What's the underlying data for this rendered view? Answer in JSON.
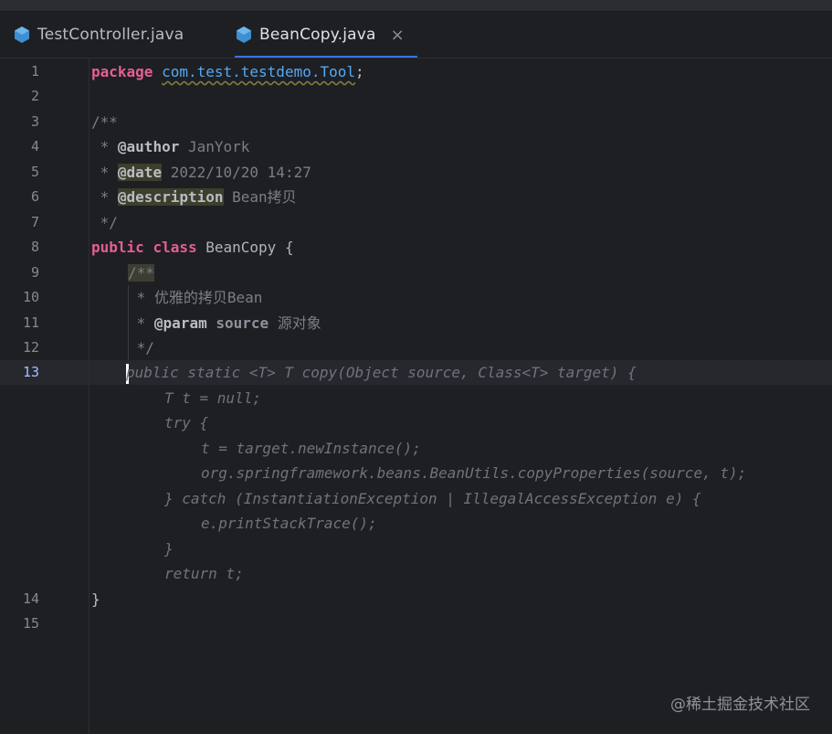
{
  "tabs": [
    {
      "label": "TestController.java",
      "icon": "java-class-icon",
      "active": false
    },
    {
      "label": "BeanCopy.java",
      "icon": "java-class-icon",
      "active": true,
      "close": "×"
    }
  ],
  "lines": {
    "n1": "1",
    "n2": "2",
    "n3": "3",
    "n4": "4",
    "n5": "5",
    "n6": "6",
    "n7": "7",
    "n8": "8",
    "n9": "9",
    "n10": "10",
    "n11": "11",
    "n12": "12",
    "n13": "13",
    "n14": "14",
    "n15": "15"
  },
  "code": {
    "l1_kw": "package",
    "l1_pkg": "com.test.testdemo.Tool",
    "l1_end": ";",
    "l3": "/**",
    "l4_star": " * ",
    "l4_tag": "@author",
    "l4_text": " JanYork",
    "l5_star": " * ",
    "l5_tag": "@date",
    "l5_text": " 2022/10/20 14:27",
    "l6_star": " * ",
    "l6_tag": "@description",
    "l6_text": " Bean拷贝",
    "l7": " */",
    "l8_kw1": "public",
    "l8_kw2": "class",
    "l8_name": " BeanCopy {",
    "l9": "/**",
    "l10": " * 优雅的拷贝Bean",
    "l11_star": " * ",
    "l11_tag": "@param",
    "l11_param": " source",
    "l11_text": " 源对象",
    "l12": " */",
    "l13": "public static <T> T copy(Object source, Class<T> target) {",
    "f1": "T t = null;",
    "f2": "try {",
    "f3": "t = target.newInstance();",
    "f4": "org.springframework.beans.BeanUtils.copyProperties(source, t);",
    "f5": "} catch (InstantiationException | IllegalAccessException e) {",
    "f6": "e.printStackTrace();",
    "f7": "}",
    "f8": "return t;",
    "l14": "}"
  },
  "watermark": "@稀土掘金技术社区",
  "colors": {
    "accent": "#3574f0",
    "keyword": "#e35f94",
    "package": "#56a8f5",
    "background": "#1e1f22"
  }
}
